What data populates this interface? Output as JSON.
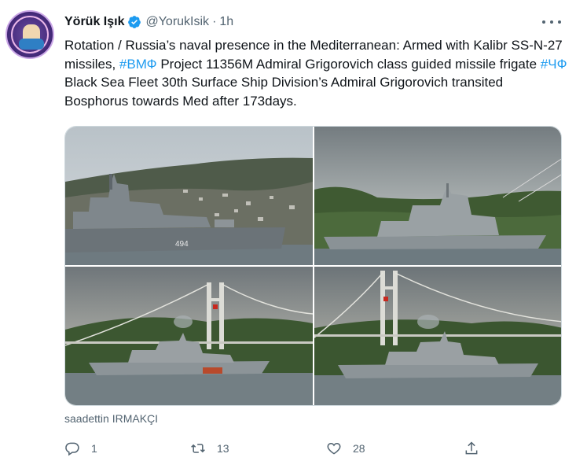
{
  "tweet": {
    "author_name": "Yörük Işık",
    "author_handle": "@YorukIsik",
    "separator": "·",
    "time": "1h",
    "text_segments": [
      {
        "text": "Rotation / Russia’s naval presence in the Mediterranean: Armed with Kalibr SS-N-27 missiles, ",
        "type": "text"
      },
      {
        "text": "#ВМФ",
        "type": "hashtag"
      },
      {
        "text": " Project 11356M Admiral Grigorovich class guided missile frigate ",
        "type": "text"
      },
      {
        "text": "#ЧФ",
        "type": "hashtag"
      },
      {
        "text": " Black Sea Fleet 30th Surface Ship Division’s Admiral Grigorovich transited Bosphorus towards Med after 173days.",
        "type": "text"
      }
    ],
    "photo_credit": "saadettin IRMAKÇI",
    "hull_number": "494",
    "stats": {
      "replies": "1",
      "retweets": "13",
      "likes": "28"
    }
  },
  "icons": {
    "verified": "verified-badge-icon",
    "more": "more-options-icon",
    "reply": "reply-icon",
    "retweet": "retweet-icon",
    "like": "heart-icon",
    "share": "share-icon"
  },
  "colors": {
    "accent": "#1d9bf0",
    "secondary_text": "#536471",
    "primary_text": "#0f1419",
    "border": "#cfd9de"
  }
}
